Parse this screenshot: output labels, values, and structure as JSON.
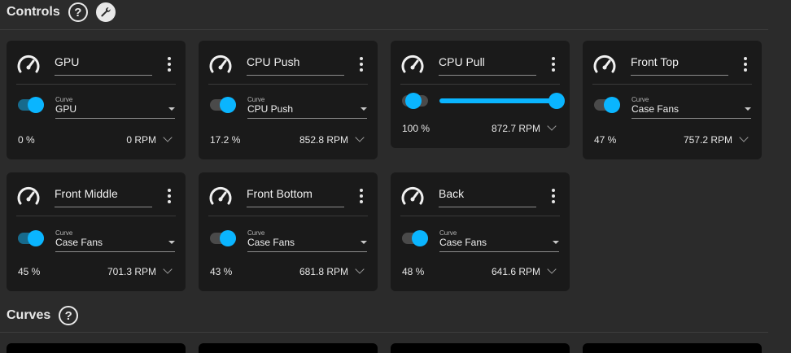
{
  "controls": {
    "title": "Controls",
    "help_icon": "question-circle-icon",
    "settings_icon": "wrench-icon",
    "cards": [
      {
        "name": "GPU",
        "mode": "curve",
        "curve_label": "Curve",
        "curve": "GPU",
        "duty": "0 %",
        "rpm": "0 RPM",
        "toggle": "on"
      },
      {
        "name": "CPU Push",
        "mode": "curve",
        "curve_label": "Curve",
        "curve": "CPU Push",
        "duty": "17.2 %",
        "rpm": "852.8 RPM",
        "toggle": "off"
      },
      {
        "name": "CPU Pull",
        "mode": "manual",
        "slider_value": 1.0,
        "duty": "100 %",
        "rpm": "872.7 RPM",
        "toggle": "off"
      },
      {
        "name": "Front Top",
        "mode": "curve",
        "curve_label": "Curve",
        "curve": "Case Fans",
        "duty": "47 %",
        "rpm": "757.2 RPM",
        "toggle": "off"
      },
      {
        "name": "Front Middle",
        "mode": "curve",
        "curve_label": "Curve",
        "curve": "Case Fans",
        "duty": "45 %",
        "rpm": "701.3 RPM",
        "toggle": "on"
      },
      {
        "name": "Front Bottom",
        "mode": "curve",
        "curve_label": "Curve",
        "curve": "Case Fans",
        "duty": "43 %",
        "rpm": "681.8 RPM",
        "toggle": "off"
      },
      {
        "name": "Back",
        "mode": "curve",
        "curve_label": "Curve",
        "curve": "Case Fans",
        "duty": "48 %",
        "rpm": "641.6 RPM",
        "toggle": "off"
      }
    ]
  },
  "curves": {
    "title": "Curves",
    "help_icon": "question-circle-icon"
  },
  "colors": {
    "accent": "#0ab5ff",
    "card_bg": "#1a1a1a",
    "page_bg": "#2b2b2b"
  }
}
